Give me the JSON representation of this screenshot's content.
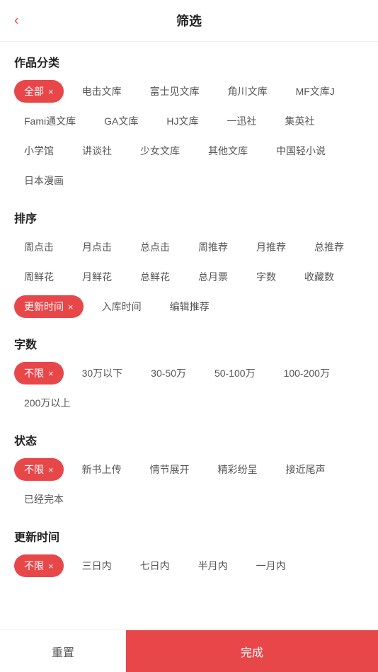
{
  "header": {
    "title": "筛选",
    "back_icon": "‹"
  },
  "sections": [
    {
      "id": "category",
      "title": "作品分类",
      "rows": [
        [
          "全部",
          "电击文库",
          "富士见文库",
          "角川文库"
        ],
        [
          "MF文库J",
          "Fami通文库",
          "GA文库",
          "HJ文库"
        ],
        [
          "一迅社",
          "集英社",
          "小学馆",
          "讲谈社",
          "少女文库"
        ],
        [
          "其他文库",
          "中国轻小说",
          "日本漫画"
        ]
      ],
      "active": [
        "全部"
      ]
    },
    {
      "id": "sort",
      "title": "排序",
      "rows": [
        [
          "周点击",
          "月点击",
          "总点击",
          "周推荐",
          "月推荐"
        ],
        [
          "总推荐",
          "周鲜花",
          "月鲜花",
          "总鲜花",
          "总月票"
        ],
        [
          "字数",
          "收藏数",
          "更新时间",
          "入库时间"
        ],
        [
          "编辑推荐"
        ]
      ],
      "active": [
        "更新时间"
      ]
    },
    {
      "id": "wordcount",
      "title": "字数",
      "rows": [
        [
          "不限",
          "30万以下",
          "30-50万",
          "50-100万"
        ],
        [
          "100-200万",
          "200万以上"
        ]
      ],
      "active": [
        "不限"
      ]
    },
    {
      "id": "status",
      "title": "状态",
      "rows": [
        [
          "不限",
          "新书上传",
          "情节展开",
          "精彩纷呈"
        ],
        [
          "接近尾声",
          "已经完本"
        ]
      ],
      "active": [
        "不限"
      ]
    },
    {
      "id": "update_time",
      "title": "更新时间",
      "rows": [
        [
          "不限",
          "三日内",
          "七日内",
          "半月内",
          "一月内"
        ]
      ],
      "active": [
        "不限"
      ]
    }
  ],
  "footer": {
    "reset_label": "重置",
    "confirm_label": "完成"
  }
}
